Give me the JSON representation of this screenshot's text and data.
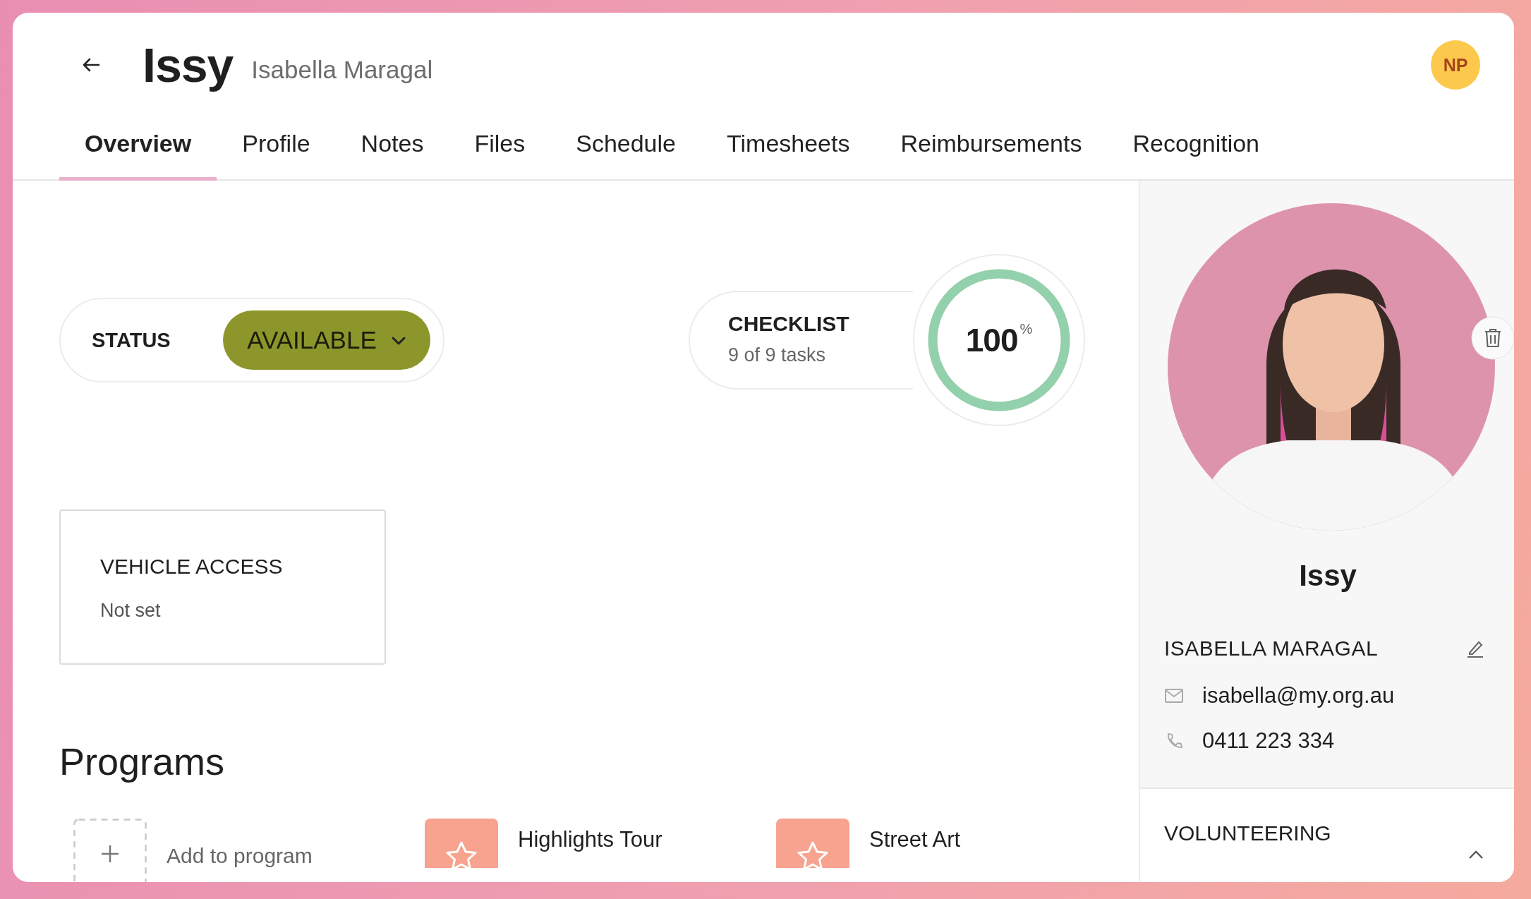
{
  "header": {
    "title": "Issy",
    "subtitle": "Isabella Maragal",
    "avatar": "NP"
  },
  "tabs": [
    {
      "label": "Overview",
      "selected": true
    },
    {
      "label": "Profile",
      "selected": false
    },
    {
      "label": "Notes",
      "selected": false
    },
    {
      "label": "Files",
      "selected": false
    },
    {
      "label": "Schedule",
      "selected": false
    },
    {
      "label": "Timesheets",
      "selected": false
    },
    {
      "label": "Reimbursements",
      "selected": false
    },
    {
      "label": "Recognition",
      "selected": false
    }
  ],
  "status": {
    "label": "STATUS",
    "value": "AVAILABLE"
  },
  "checklist": {
    "title": "CHECKLIST",
    "detail": "9 of 9 tasks",
    "percent": "100",
    "unit": "%",
    "level": 1
  },
  "vehicle_access": {
    "title": "VEHICLE ACCESS",
    "value": "Not set"
  },
  "programs": {
    "heading": "Programs",
    "add_label": "Add to program",
    "items": [
      {
        "name": "Highlights Tour"
      },
      {
        "name": "Street Art"
      }
    ]
  },
  "profile": {
    "name": "Issy",
    "full_name": "ISABELLA MARAGAL",
    "email": "isabella@my.org.au",
    "phone": "0411 223 334"
  },
  "sections": [
    {
      "title": "VOLUNTEERING",
      "expanded": true
    }
  ]
}
